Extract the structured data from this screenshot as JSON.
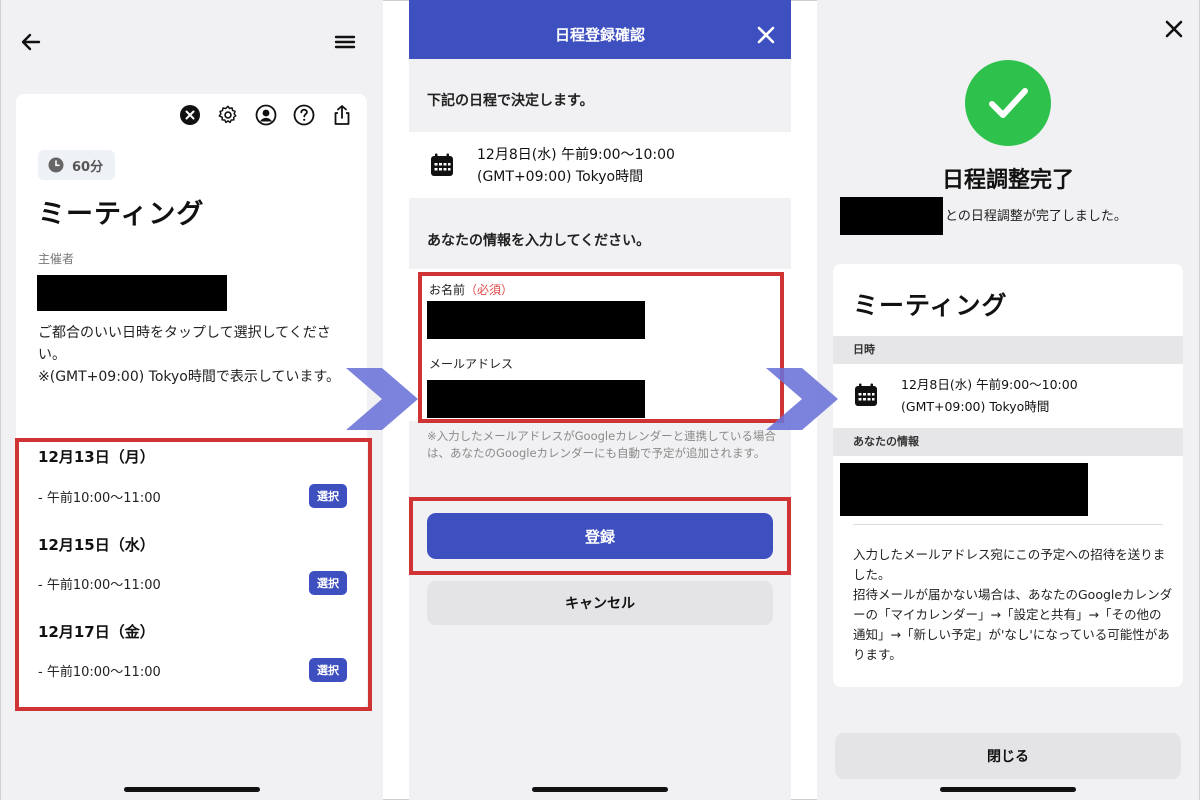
{
  "screen1": {
    "duration": "60分",
    "event_title": "ミーティング",
    "organizer_label": "主催者",
    "description_line1": "ご都合のいい日時をタップして選択してください。",
    "description_line2": "※(GMT+09:00) Tokyo時間で表示しています。",
    "slots": [
      {
        "date": "12月13日（月）",
        "time": "- 午前10:00〜11:00",
        "button": "選択"
      },
      {
        "date": "12月15日（水）",
        "time": "- 午前10:00〜11:00",
        "button": "選択"
      },
      {
        "date": "12月17日（金）",
        "time": "- 午前10:00〜11:00",
        "button": "選択"
      }
    ]
  },
  "screen2": {
    "header_title": "日程登録確認",
    "decision_text": "下記の日程で決定します。",
    "datetime_line1": "12月8日(水) 午前9:00〜10:00",
    "datetime_line2": "(GMT+09:00) Tokyo時間",
    "info_prompt": "あなたの情報を入力してください。",
    "name_label": "お名前",
    "required_label": "（必須）",
    "email_label": "メールアドレス",
    "note": "※入力したメールアドレスがGoogleカレンダーと連携している場合は、あなたのGoogleカレンダーにも自動で予定が追加されます。",
    "register_button": "登録",
    "cancel_button": "キャンセル"
  },
  "screen3": {
    "done_title": "日程調整完了",
    "done_subtitle": "との日程調整が完了しました。",
    "event_title": "ミーティング",
    "datetime_section": "日時",
    "datetime_line1": "12月8日(水) 午前9:00〜10:00",
    "datetime_line2": "(GMT+09:00) Tokyo時間",
    "your_info_section": "あなたの情報",
    "invite_line1": "入力したメールアドレス宛にこの予定への招待を送りました。",
    "invite_line2": "招待メールが届かない場合は、あなたのGoogleカレンダーの「マイカレンダー」→「設定と共有」→「その他の通知」→「新しい予定」が'なし'になっている可能性があります。",
    "close_button": "閉じる"
  },
  "colors": {
    "accent": "#3e4fbf",
    "highlight_border": "#cf3333",
    "success": "#2ec24c",
    "flow_arrow": "#6a72d8"
  }
}
